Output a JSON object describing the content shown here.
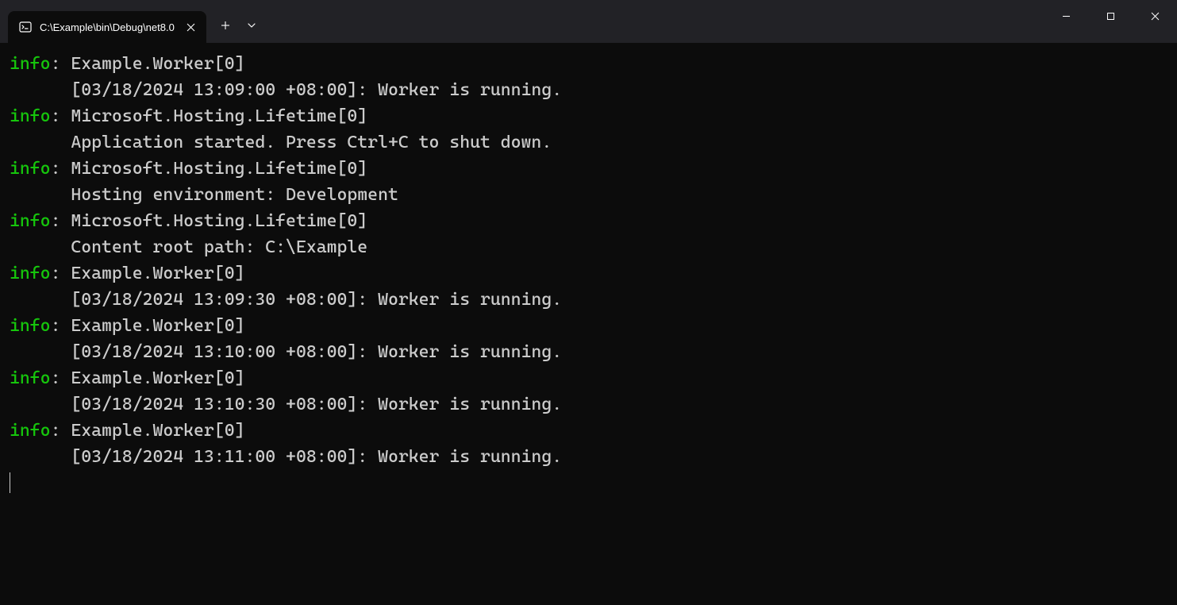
{
  "titlebar": {
    "tab_title": "C:\\Example\\bin\\Debug\\net8.0",
    "tab_icon_name": "terminal-icon"
  },
  "log_entries": [
    {
      "level": "info",
      "source": "Example.Worker[0]",
      "message": "[03/18/2024 13:09:00 +08:00]: Worker is running."
    },
    {
      "level": "info",
      "source": "Microsoft.Hosting.Lifetime[0]",
      "message": "Application started. Press Ctrl+C to shut down."
    },
    {
      "level": "info",
      "source": "Microsoft.Hosting.Lifetime[0]",
      "message": "Hosting environment: Development"
    },
    {
      "level": "info",
      "source": "Microsoft.Hosting.Lifetime[0]",
      "message": "Content root path: C:\\Example"
    },
    {
      "level": "info",
      "source": "Example.Worker[0]",
      "message": "[03/18/2024 13:09:30 +08:00]: Worker is running."
    },
    {
      "level": "info",
      "source": "Example.Worker[0]",
      "message": "[03/18/2024 13:10:00 +08:00]: Worker is running."
    },
    {
      "level": "info",
      "source": "Example.Worker[0]",
      "message": "[03/18/2024 13:10:30 +08:00]: Worker is running."
    },
    {
      "level": "info",
      "source": "Example.Worker[0]",
      "message": "[03/18/2024 13:11:00 +08:00]: Worker is running."
    }
  ],
  "colors": {
    "info_level": "#16c60c",
    "text": "#cccccc",
    "background": "#0c0c0c",
    "titlebar_bg": "#222226"
  }
}
